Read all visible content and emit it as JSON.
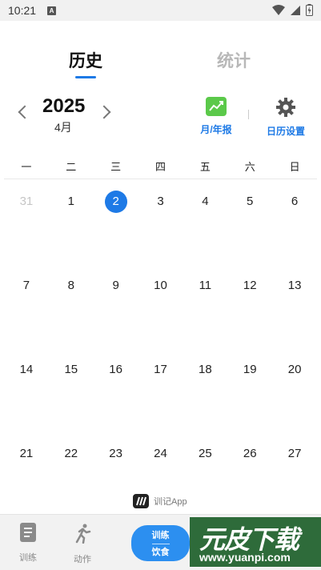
{
  "status_bar": {
    "time": "10:21",
    "notif_letter": "A"
  },
  "tabs": {
    "history": "历史",
    "stats": "统计"
  },
  "year_nav": {
    "year": "2025",
    "month": "4月"
  },
  "tools": {
    "report_label": "月/年报",
    "settings_label": "日历设置"
  },
  "weekdays": [
    "一",
    "二",
    "三",
    "四",
    "五",
    "六",
    "日"
  ],
  "calendar": {
    "rows": [
      [
        "31",
        "1",
        "2",
        "3",
        "4",
        "5",
        "6"
      ],
      [
        "7",
        "8",
        "9",
        "10",
        "11",
        "12",
        "13"
      ],
      [
        "14",
        "15",
        "16",
        "17",
        "18",
        "19",
        "20"
      ],
      [
        "21",
        "22",
        "23",
        "24",
        "25",
        "26",
        "27"
      ]
    ],
    "today": "2"
  },
  "app_brand": {
    "name": "训记App"
  },
  "bottom_nav": {
    "train_label": "训练",
    "action_label": "动作",
    "toggle_top": "训练",
    "toggle_bottom": "饮食"
  },
  "watermark": {
    "text": "元皮下载",
    "url": "www.yuanpi.com"
  },
  "colors": {
    "accent": "#1e7ae6",
    "report_icon": "#5bc94a",
    "banner": "#2e6b3a"
  }
}
